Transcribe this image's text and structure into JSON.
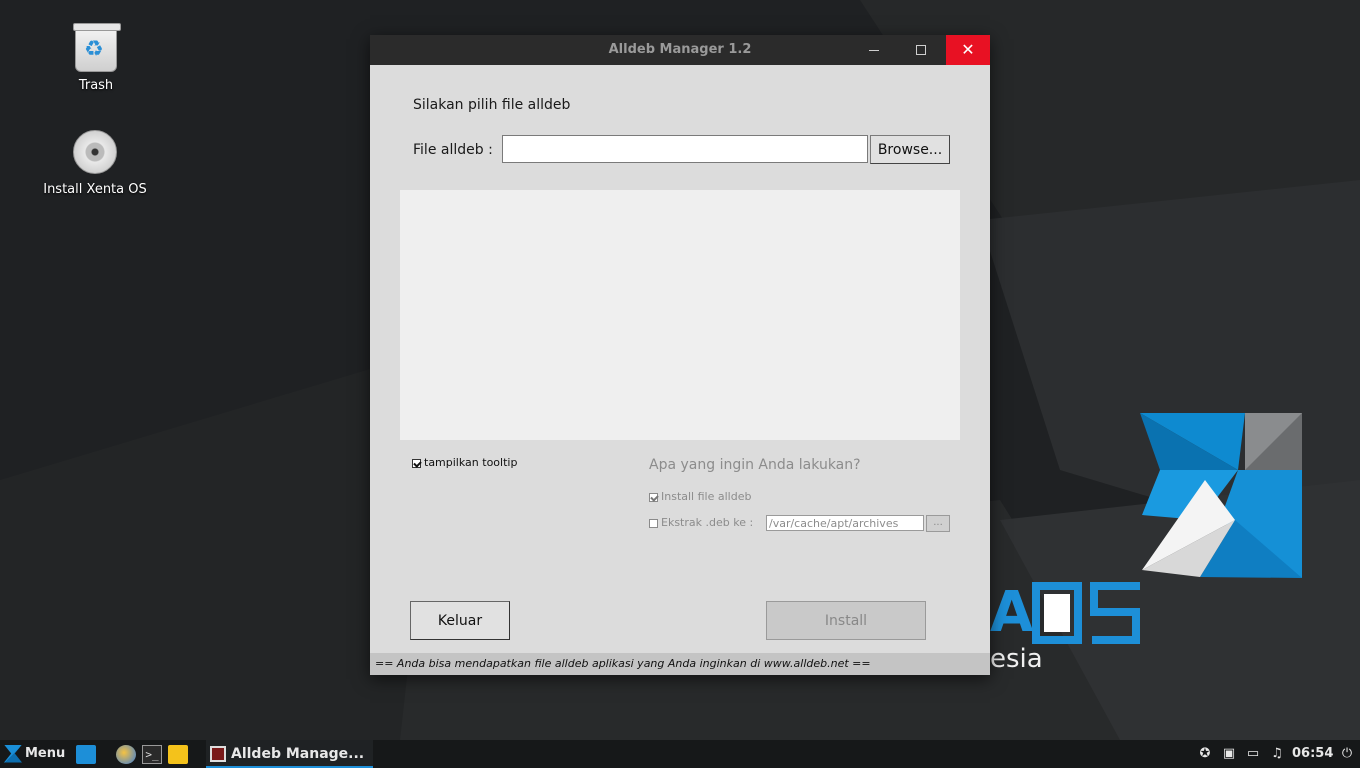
{
  "desktop": {
    "icons": [
      {
        "label": "Trash",
        "icon": "trash-icon"
      },
      {
        "label": "Install Xenta OS",
        "icon": "disc-icon"
      }
    ],
    "wallpaper_text": {
      "brand": "A OS",
      "sub": "esia"
    }
  },
  "window": {
    "title": "Alldeb Manager 1.2",
    "controls": {
      "minimize": "—",
      "maximize": "☐",
      "close": "✕"
    },
    "prompt": "Silakan pilih file alldeb",
    "file_label": "File alldeb :",
    "file_value": "",
    "browse_label": "Browse...",
    "tooltip_label": "tampilkan tooltip",
    "tooltip_checked": true,
    "question": "Apa yang ingin Anda lakukan?",
    "install_option": "Install file alldeb",
    "install_checked": true,
    "extract_option": "Ekstrak .deb ke :",
    "extract_checked": false,
    "extract_path": "/var/cache/apt/archives",
    "dots_label": "...",
    "keluar_label": "Keluar",
    "install_label": "Install",
    "status_text": "== Anda bisa mendapatkan file alldeb aplikasi yang Anda inginkan di www.alldeb.net =="
  },
  "taskbar": {
    "menu_label": "Menu",
    "active_task": "Alldeb Manage...",
    "clock": "06:54"
  },
  "colors": {
    "accent": "#1d8fd8",
    "close": "#e81123",
    "titlebar": "#2b2b2b"
  }
}
